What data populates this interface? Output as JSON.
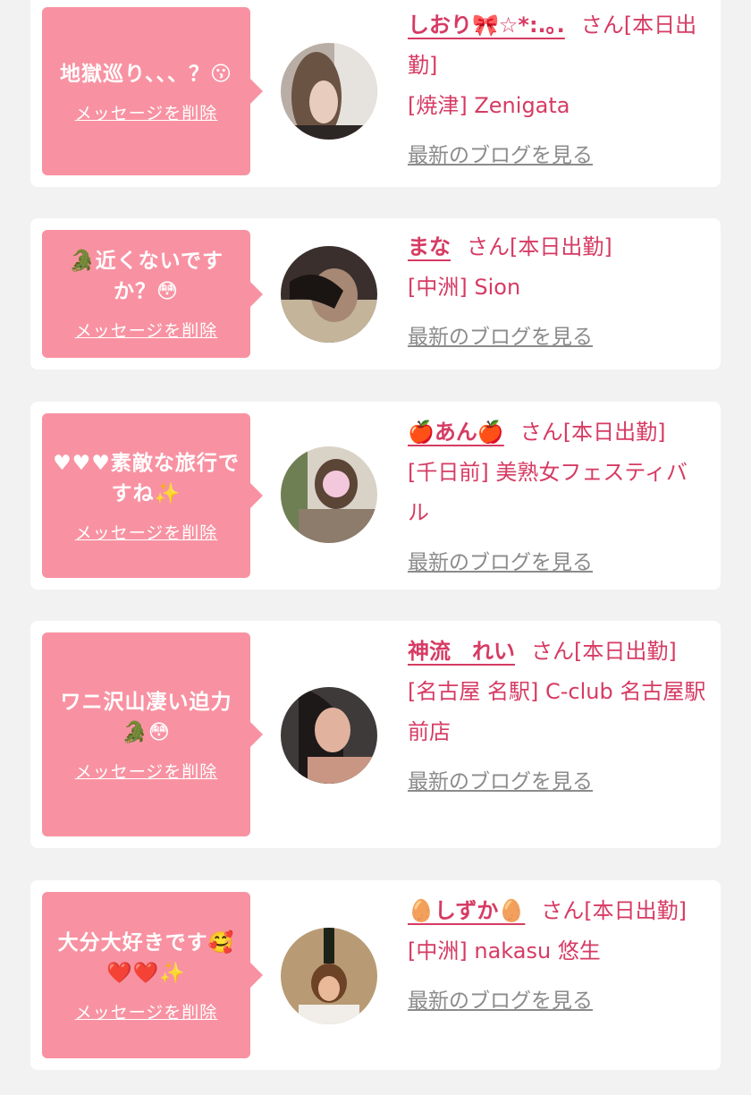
{
  "cards": [
    {
      "message": "地獄巡り、、、？😗",
      "delete_label": "メッセージを削除",
      "name": "しおり🎀☆*:.｡.",
      "suffix": "さん[本日出勤]",
      "shop": "[焼津] Zenigata",
      "blog_label": "最新のブログを見る"
    },
    {
      "message": "🐊近くないですか？😳",
      "delete_label": "メッセージを削除",
      "name": "まな",
      "suffix": "さん[本日出勤]",
      "shop": "[中洲] Sion",
      "blog_label": "最新のブログを見る"
    },
    {
      "message": "♥♥♥素敵な旅行ですね✨",
      "delete_label": "メッセージを削除",
      "name": "🍎あん🍎",
      "suffix": "さん[本日出勤]",
      "shop": "[千日前] 美熟女フェスティバル",
      "blog_label": "最新のブログを見る"
    },
    {
      "message": "ワニ沢山凄い迫力🐊😳",
      "delete_label": "メッセージを削除",
      "name": "神流　れい",
      "suffix": "さん[本日出勤]",
      "shop": "[名古屋 名駅] C-club 名古屋駅前店",
      "blog_label": "最新のブログを見る"
    },
    {
      "message": "大分大好きです🥰❤️❤️✨",
      "delete_label": "メッセージを削除",
      "name": "🥚しずか🥚",
      "suffix": "さん[本日出勤]",
      "shop": "[中洲] nakasu 悠生",
      "blog_label": "最新のブログを見る"
    }
  ]
}
